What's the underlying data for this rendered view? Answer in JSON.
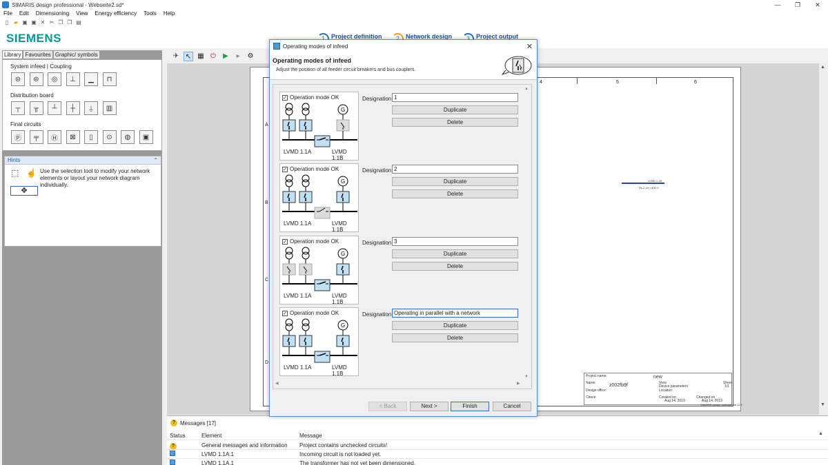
{
  "window": {
    "title": "SIMARIS design professional - Webseite2.sd*",
    "min": "—",
    "max": "❐",
    "close": "✕"
  },
  "menu": [
    "File",
    "Edit",
    "Dimensioning",
    "View",
    "Energy efficiency",
    "Tools",
    "Help"
  ],
  "brand": {
    "logo": "SIEMENS",
    "brand_color": "#009999"
  },
  "steps": [
    {
      "num": "1",
      "label": "Project definition"
    },
    {
      "num": "2",
      "label": "Network design"
    },
    {
      "num": "3",
      "label": "Project output"
    }
  ],
  "library": {
    "tabs": [
      "Library",
      "Favourites",
      "Graphic/ symbols"
    ],
    "sections": [
      "System infeed | Coupling",
      "Distribution board",
      "Final circuits"
    ]
  },
  "hints": {
    "title": "Hints",
    "text": "Use the selection tool to modify your network elements or layout your network diagram individually."
  },
  "sheet": {
    "columns": [
      "4",
      "5",
      "6"
    ],
    "rows": [
      "A",
      "B",
      "C",
      "D"
    ],
    "bus_label": "LVMD 1.1B",
    "bus_sub": "TN-C  Un =400 V",
    "titleblock": {
      "project_label": "Project name:",
      "project": "new",
      "name_label": "Name:",
      "name": "z002fb9f",
      "view_label": "View",
      "view": "Device parameters",
      "sheet_label": "Sheet",
      "sheet": "1/1",
      "design_label": "Design office:",
      "location_label": "Location:",
      "check_label": "Check:",
      "created_label": "Created on",
      "created": "Aug 14, 2019",
      "changed_label": "Changed on",
      "changed": "Aug 14, 2019",
      "footer": "SIMARIS design professional 12.1"
    }
  },
  "messages": {
    "title": "Messages [17]",
    "headers": [
      "Status",
      "Element",
      "Message"
    ],
    "rows": [
      {
        "status": "warning",
        "element": "General messages and information",
        "message": "Project contains unchecked circuits!"
      },
      {
        "status": "info",
        "element": "LVMD 1.1A.1",
        "message": "Incoming circuit is not loaded yet."
      },
      {
        "status": "info",
        "element": "LVMD 1.1A.1",
        "message": "The transformer has not yet been dimensioned."
      }
    ]
  },
  "dialog": {
    "title": "Operating modes of infeed",
    "heading": "Operating modes of infeed",
    "subheading": "Adjust the position of all feeder circuit breakers and bus couplers.",
    "designation_label": "Designation",
    "duplicate_label": "Duplicate",
    "delete_label": "Delete",
    "check_label": "Operation mode OK",
    "bus_left": "LVMD 1.1A",
    "bus_right": "LVMD 1.1B",
    "modes": [
      {
        "designation": "1",
        "checked": true
      },
      {
        "designation": "2",
        "checked": true
      },
      {
        "designation": "3",
        "checked": true
      },
      {
        "designation": "Operating in parallel with a network",
        "checked": true
      }
    ],
    "buttons": {
      "back": "< Back",
      "next": "Next >",
      "finish": "Finish",
      "cancel": "Cancel"
    }
  },
  "colors": {
    "accent": "#2b6cd8",
    "active_breaker": "#bfe0f5",
    "inactive_breaker": "#dcdcdc",
    "bus": "#000000"
  }
}
